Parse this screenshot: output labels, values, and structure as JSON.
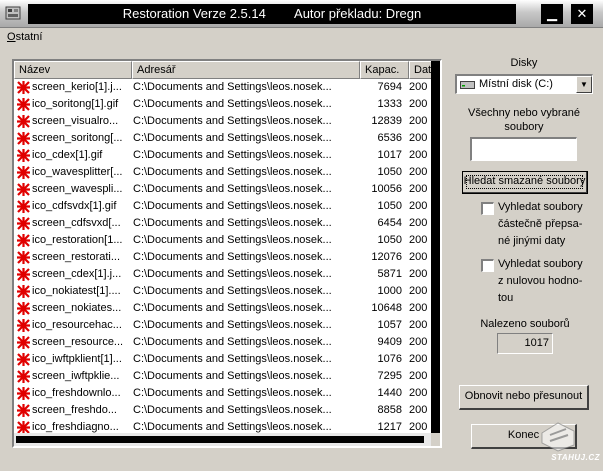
{
  "window": {
    "title": "Restoration Verze 2.5.14        Autor překladu: Dregn",
    "minimize_glyph": "▁",
    "close_glyph": "✕"
  },
  "menu": {
    "items": [
      {
        "label_accel": "O",
        "label_rest": "statní"
      }
    ]
  },
  "filelist": {
    "columns": [
      "Název",
      "Adresář",
      "Kapac.",
      "Datu"
    ],
    "rows": [
      {
        "name": "screen_kerio[1].j...",
        "path": "C:\\Documents and Settings\\leos.nosek...",
        "size": "7694",
        "date": "200"
      },
      {
        "name": "ico_soritong[1].gif",
        "path": "C:\\Documents and Settings\\leos.nosek...",
        "size": "1333",
        "date": "200"
      },
      {
        "name": "screen_visualro...",
        "path": "C:\\Documents and Settings\\leos.nosek...",
        "size": "12839",
        "date": "200"
      },
      {
        "name": "screen_soritong[...",
        "path": "C:\\Documents and Settings\\leos.nosek...",
        "size": "6536",
        "date": "200"
      },
      {
        "name": "ico_cdex[1].gif",
        "path": "C:\\Documents and Settings\\leos.nosek...",
        "size": "1017",
        "date": "200"
      },
      {
        "name": "ico_wavesplitter[...",
        "path": "C:\\Documents and Settings\\leos.nosek...",
        "size": "1050",
        "date": "200"
      },
      {
        "name": "screen_wavespli...",
        "path": "C:\\Documents and Settings\\leos.nosek...",
        "size": "10056",
        "date": "200"
      },
      {
        "name": "ico_cdfsvdx[1].gif",
        "path": "C:\\Documents and Settings\\leos.nosek...",
        "size": "1050",
        "date": "200"
      },
      {
        "name": "screen_cdfsvxd[...",
        "path": "C:\\Documents and Settings\\leos.nosek...",
        "size": "6454",
        "date": "200"
      },
      {
        "name": "ico_restoration[1...",
        "path": "C:\\Documents and Settings\\leos.nosek...",
        "size": "1050",
        "date": "200"
      },
      {
        "name": "screen_restorati...",
        "path": "C:\\Documents and Settings\\leos.nosek...",
        "size": "12076",
        "date": "200"
      },
      {
        "name": "screen_cdex[1].j...",
        "path": "C:\\Documents and Settings\\leos.nosek...",
        "size": "5871",
        "date": "200"
      },
      {
        "name": "ico_nokiatest[1]....",
        "path": "C:\\Documents and Settings\\leos.nosek...",
        "size": "1000",
        "date": "200"
      },
      {
        "name": "screen_nokiates...",
        "path": "C:\\Documents and Settings\\leos.nosek...",
        "size": "10648",
        "date": "200"
      },
      {
        "name": "ico_resourcehac...",
        "path": "C:\\Documents and Settings\\leos.nosek...",
        "size": "1057",
        "date": "200"
      },
      {
        "name": "screen_resource...",
        "path": "C:\\Documents and Settings\\leos.nosek...",
        "size": "9409",
        "date": "200"
      },
      {
        "name": "ico_iwftpklient[1]...",
        "path": "C:\\Documents and Settings\\leos.nosek...",
        "size": "1076",
        "date": "200"
      },
      {
        "name": "screen_iwftpklie...",
        "path": "C:\\Documents and Settings\\leos.nosek...",
        "size": "7295",
        "date": "200"
      },
      {
        "name": "ico_freshdownlo...",
        "path": "C:\\Documents and Settings\\leos.nosek...",
        "size": "1440",
        "date": "200"
      },
      {
        "name": "screen_freshdo...",
        "path": "C:\\Documents and Settings\\leos.nosek...",
        "size": "8858",
        "date": "200"
      },
      {
        "name": "ico_freshdiagno...",
        "path": "C:\\Documents and Settings\\leos.nosek...",
        "size": "1217",
        "date": "200"
      }
    ]
  },
  "side": {
    "disks_label": "Disky",
    "disk_selected": "Místní disk (C:)",
    "files_label_line1": "Všechny nebo vybrané",
    "files_label_line2": "soubory",
    "files_input_value": "",
    "search_button": "Hledat smazané soubory",
    "opt_partial_line1": "Vyhledat soubory",
    "opt_partial_line2": "částečně přepsa-",
    "opt_partial_line3": "né jinými daty",
    "opt_zero_line1": "Vyhledat soubory",
    "opt_zero_line2": "z nulovou hodno-",
    "opt_zero_line3": "tou",
    "found_label": "Nalezeno souborů",
    "found_count": "1017",
    "restore_button": "Obnovit nebo přesunout",
    "end_button": "Konec"
  },
  "watermark": {
    "text": "STAHUJ.CZ"
  },
  "icons": {
    "row": "deleted-file-icon",
    "disk": "hard-disk-icon",
    "app": "app-icon"
  },
  "colors": {
    "face": "#d4d0c8",
    "deleted_icon": "#e00000"
  }
}
